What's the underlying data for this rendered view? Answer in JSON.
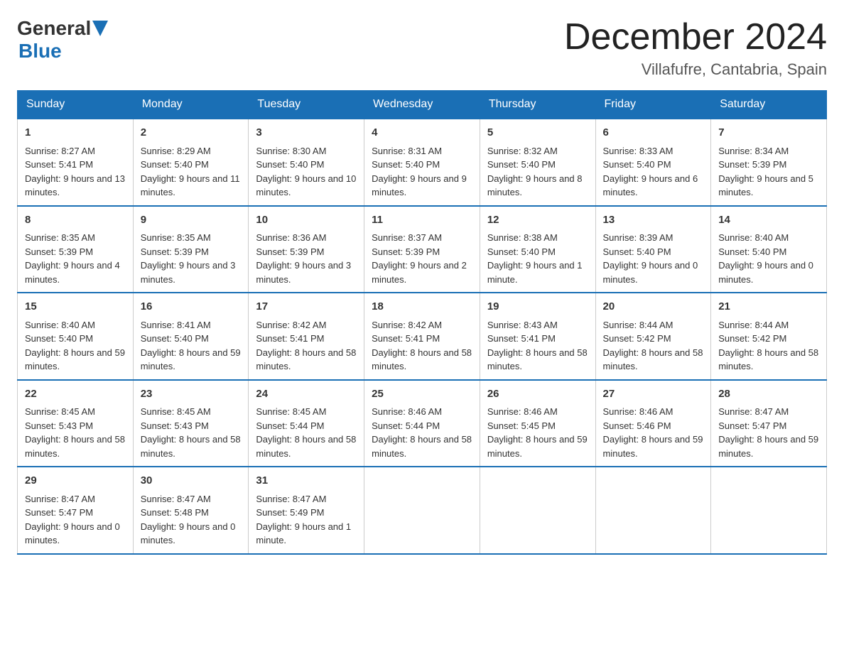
{
  "logo": {
    "general": "General",
    "blue": "Blue"
  },
  "header": {
    "month": "December 2024",
    "location": "Villafufre, Cantabria, Spain"
  },
  "days": [
    "Sunday",
    "Monday",
    "Tuesday",
    "Wednesday",
    "Thursday",
    "Friday",
    "Saturday"
  ],
  "weeks": [
    [
      {
        "num": "1",
        "sunrise": "8:27 AM",
        "sunset": "5:41 PM",
        "daylight": "9 hours and 13 minutes."
      },
      {
        "num": "2",
        "sunrise": "8:29 AM",
        "sunset": "5:40 PM",
        "daylight": "9 hours and 11 minutes."
      },
      {
        "num": "3",
        "sunrise": "8:30 AM",
        "sunset": "5:40 PM",
        "daylight": "9 hours and 10 minutes."
      },
      {
        "num": "4",
        "sunrise": "8:31 AM",
        "sunset": "5:40 PM",
        "daylight": "9 hours and 9 minutes."
      },
      {
        "num": "5",
        "sunrise": "8:32 AM",
        "sunset": "5:40 PM",
        "daylight": "9 hours and 8 minutes."
      },
      {
        "num": "6",
        "sunrise": "8:33 AM",
        "sunset": "5:40 PM",
        "daylight": "9 hours and 6 minutes."
      },
      {
        "num": "7",
        "sunrise": "8:34 AM",
        "sunset": "5:39 PM",
        "daylight": "9 hours and 5 minutes."
      }
    ],
    [
      {
        "num": "8",
        "sunrise": "8:35 AM",
        "sunset": "5:39 PM",
        "daylight": "9 hours and 4 minutes."
      },
      {
        "num": "9",
        "sunrise": "8:35 AM",
        "sunset": "5:39 PM",
        "daylight": "9 hours and 3 minutes."
      },
      {
        "num": "10",
        "sunrise": "8:36 AM",
        "sunset": "5:39 PM",
        "daylight": "9 hours and 3 minutes."
      },
      {
        "num": "11",
        "sunrise": "8:37 AM",
        "sunset": "5:39 PM",
        "daylight": "9 hours and 2 minutes."
      },
      {
        "num": "12",
        "sunrise": "8:38 AM",
        "sunset": "5:40 PM",
        "daylight": "9 hours and 1 minute."
      },
      {
        "num": "13",
        "sunrise": "8:39 AM",
        "sunset": "5:40 PM",
        "daylight": "9 hours and 0 minutes."
      },
      {
        "num": "14",
        "sunrise": "8:40 AM",
        "sunset": "5:40 PM",
        "daylight": "9 hours and 0 minutes."
      }
    ],
    [
      {
        "num": "15",
        "sunrise": "8:40 AM",
        "sunset": "5:40 PM",
        "daylight": "8 hours and 59 minutes."
      },
      {
        "num": "16",
        "sunrise": "8:41 AM",
        "sunset": "5:40 PM",
        "daylight": "8 hours and 59 minutes."
      },
      {
        "num": "17",
        "sunrise": "8:42 AM",
        "sunset": "5:41 PM",
        "daylight": "8 hours and 58 minutes."
      },
      {
        "num": "18",
        "sunrise": "8:42 AM",
        "sunset": "5:41 PM",
        "daylight": "8 hours and 58 minutes."
      },
      {
        "num": "19",
        "sunrise": "8:43 AM",
        "sunset": "5:41 PM",
        "daylight": "8 hours and 58 minutes."
      },
      {
        "num": "20",
        "sunrise": "8:44 AM",
        "sunset": "5:42 PM",
        "daylight": "8 hours and 58 minutes."
      },
      {
        "num": "21",
        "sunrise": "8:44 AM",
        "sunset": "5:42 PM",
        "daylight": "8 hours and 58 minutes."
      }
    ],
    [
      {
        "num": "22",
        "sunrise": "8:45 AM",
        "sunset": "5:43 PM",
        "daylight": "8 hours and 58 minutes."
      },
      {
        "num": "23",
        "sunrise": "8:45 AM",
        "sunset": "5:43 PM",
        "daylight": "8 hours and 58 minutes."
      },
      {
        "num": "24",
        "sunrise": "8:45 AM",
        "sunset": "5:44 PM",
        "daylight": "8 hours and 58 minutes."
      },
      {
        "num": "25",
        "sunrise": "8:46 AM",
        "sunset": "5:44 PM",
        "daylight": "8 hours and 58 minutes."
      },
      {
        "num": "26",
        "sunrise": "8:46 AM",
        "sunset": "5:45 PM",
        "daylight": "8 hours and 59 minutes."
      },
      {
        "num": "27",
        "sunrise": "8:46 AM",
        "sunset": "5:46 PM",
        "daylight": "8 hours and 59 minutes."
      },
      {
        "num": "28",
        "sunrise": "8:47 AM",
        "sunset": "5:47 PM",
        "daylight": "8 hours and 59 minutes."
      }
    ],
    [
      {
        "num": "29",
        "sunrise": "8:47 AM",
        "sunset": "5:47 PM",
        "daylight": "9 hours and 0 minutes."
      },
      {
        "num": "30",
        "sunrise": "8:47 AM",
        "sunset": "5:48 PM",
        "daylight": "9 hours and 0 minutes."
      },
      {
        "num": "31",
        "sunrise": "8:47 AM",
        "sunset": "5:49 PM",
        "daylight": "9 hours and 1 minute."
      },
      null,
      null,
      null,
      null
    ]
  ]
}
